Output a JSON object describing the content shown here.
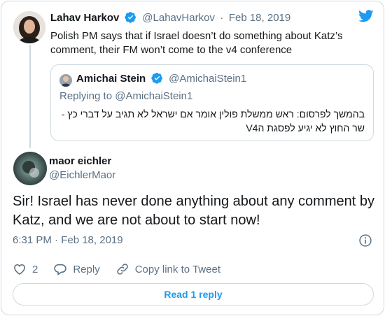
{
  "parent_tweet": {
    "name": "Lahav Harkov",
    "handle": "@LahavHarkov",
    "separator": "·",
    "date": "Feb 18, 2019",
    "text": "Polish PM says that if Israel doesn’t do something about Katz’s comment, their FM won’t come to the v4 conference"
  },
  "quoted_tweet": {
    "name": "Amichai Stein",
    "handle": "@AmichaiStein1",
    "replying_prefix": "Replying to ",
    "replying_handle": "@AmichaiStein1",
    "text_line1": "בהמשך לפרסום: ראש ממשלת פולין אומר אם ישראל לא תגיב על דברי כץ -",
    "text_line2": "שר החוץ לא יגיע לפסגת הV4"
  },
  "main_tweet": {
    "name": "maor eichler",
    "handle": "@EichlerMaor",
    "text": "Sir! Israel has never done anything about any comment by Katz, and we are not about to start now!",
    "time": "6:31 PM · Feb 18, 2019"
  },
  "actions": {
    "like_count": "2",
    "reply_label": "Reply",
    "copy_link_label": "Copy link to Tweet"
  },
  "read_reply_label": "Read 1 reply",
  "colors": {
    "accent": "#1d9bf0",
    "like_hover": "#e0245e",
    "muted": "#5b7083",
    "border": "#cfd9de"
  },
  "icons": [
    "twitter-logo-icon",
    "verified-badge-icon",
    "info-icon",
    "heart-icon",
    "reply-icon",
    "link-icon"
  ]
}
